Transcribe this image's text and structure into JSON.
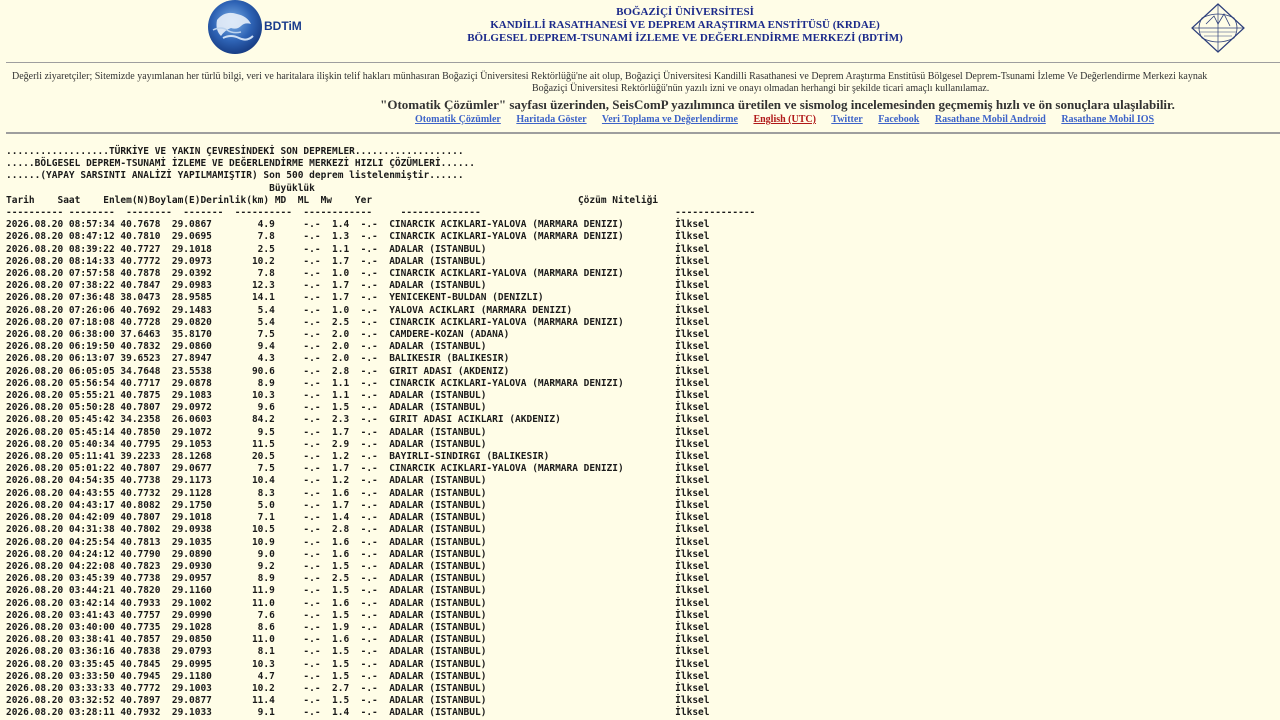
{
  "header": {
    "logo_left_text": "BDTiM",
    "university": "BOĞAZİÇİ ÜNİVERSİTESİ",
    "institute": "KANDİLLİ RASATHANESİ VE DEPREM ARAŞTIRMA ENSTİTÜSÜ (KRDAE)",
    "center": "BÖLGESEL DEPREM-TSUNAMİ İZLEME VE DEĞERLENDİRME MERKEZİ (BDTİM)",
    "colors": {
      "title": "#1B2A8A",
      "background": "#FFFDE7",
      "link": "#3D63C8",
      "link_red": "#B01818"
    },
    "icons": [
      "bdtim-logo-icon",
      "kandilli-logo-icon"
    ]
  },
  "notice": {
    "line1": "Değerli ziyaretçiler; Sitemizde yayımlanan her türlü bilgi, veri ve haritalara ilişkin telif hakları münhasıran Boğaziçi Üniversitesi Rektörlüğü'ne ait olup, Boğaziçi Üniversitesi Kandilli Rasathanesi ve Deprem Araştırma Enstitüsü Bölgesel Deprem-Tsunami İzleme Ve Değerlendirme Merkezi kaynak",
    "line2": "Boğaziçi Üniversitesi Rektörlüğü'nün yazılı izni ve onayı olmadan herhangi bir şekilde ticari amaçlı kullanılamaz."
  },
  "tagline": "\"Otomatik Çözümler\" sayfası üzerinden, SeisComP yazılımınca üretilen ve sismolog incelemesinden geçmemiş hızlı ve ön sonuçlara ulaşılabilir.",
  "nav": [
    "Otomatik Çözümler",
    "Haritada Göster",
    "Veri Toplama ve Değerlendirme",
    "English (UTC)",
    "Twitter",
    "Facebook",
    "Rasathane Mobil Android",
    "Rasathane Mobil IOS"
  ],
  "listing": {
    "banner": [
      "..................TÜRKİYE VE YAKIN ÇEVRESİNDEKİ SON DEPREMLER...................",
      ".....BÖLGESEL DEPREM-TSUNAMİ İZLEME VE DEĞERLENDİRME MERKEZİ HIZLI ÇÖZÜMLERİ......",
      "......(YAPAY SARSINTI ANALİZİ YAPILMAMIŞTIR) Son 500 deprem listelenmiştir......"
    ],
    "magnitude_header": "Büyüklük",
    "columns": [
      "Tarih",
      "Saat",
      "Enlem(N)",
      "Boylam(E)",
      "Derinlik(km)",
      "MD",
      "ML",
      "Mw",
      "Yer",
      "Çözüm Niteliği"
    ],
    "rows": [
      [
        "2026.08.20",
        "08:57:34",
        "40.7678",
        "29.0867",
        "4.9",
        "-.-",
        "1.4",
        "-.-",
        "CINARCIK ACIKLARI-YALOVA (MARMARA DENIZI)",
        "İlksel"
      ],
      [
        "2026.08.20",
        "08:47:12",
        "40.7810",
        "29.0695",
        "7.8",
        "-.-",
        "1.3",
        "-.-",
        "CINARCIK ACIKLARI-YALOVA (MARMARA DENIZI)",
        "İlksel"
      ],
      [
        "2026.08.20",
        "08:39:22",
        "40.7727",
        "29.1018",
        "2.5",
        "-.-",
        "1.1",
        "-.-",
        "ADALAR (ISTANBUL)",
        "İlksel"
      ],
      [
        "2026.08.20",
        "08:14:33",
        "40.7772",
        "29.0973",
        "10.2",
        "-.-",
        "1.7",
        "-.-",
        "ADALAR (ISTANBUL)",
        "İlksel"
      ],
      [
        "2026.08.20",
        "07:57:58",
        "40.7878",
        "29.0392",
        "7.8",
        "-.-",
        "1.0",
        "-.-",
        "CINARCIK ACIKLARI-YALOVA (MARMARA DENIZI)",
        "İlksel"
      ],
      [
        "2026.08.20",
        "07:38:22",
        "40.7847",
        "29.0983",
        "12.3",
        "-.-",
        "1.7",
        "-.-",
        "ADALAR (ISTANBUL)",
        "İlksel"
      ],
      [
        "2026.08.20",
        "07:36:48",
        "38.0473",
        "28.9585",
        "14.1",
        "-.-",
        "1.7",
        "-.-",
        "YENICEKENT-BULDAN (DENIZLI)",
        "İlksel"
      ],
      [
        "2026.08.20",
        "07:26:06",
        "40.7692",
        "29.1483",
        "5.4",
        "-.-",
        "1.0",
        "-.-",
        "YALOVA ACIKLARI (MARMARA DENIZI)",
        "İlksel"
      ],
      [
        "2026.08.20",
        "07:18:08",
        "40.7728",
        "29.0820",
        "5.4",
        "-.-",
        "2.5",
        "-.-",
        "CINARCIK ACIKLARI-YALOVA (MARMARA DENIZI)",
        "İlksel"
      ],
      [
        "2026.08.20",
        "06:38:00",
        "37.6463",
        "35.8170",
        "7.5",
        "-.-",
        "2.0",
        "-.-",
        "CAMDERE-KOZAN (ADANA)",
        "İlksel"
      ],
      [
        "2026.08.20",
        "06:19:50",
        "40.7832",
        "29.0860",
        "9.4",
        "-.-",
        "2.0",
        "-.-",
        "ADALAR (ISTANBUL)",
        "İlksel"
      ],
      [
        "2026.08.20",
        "06:13:07",
        "39.6523",
        "27.8947",
        "4.3",
        "-.-",
        "2.0",
        "-.-",
        "BALIKESIR (BALIKESIR)",
        "İlksel"
      ],
      [
        "2026.08.20",
        "06:05:05",
        "34.7648",
        "23.5538",
        "90.6",
        "-.-",
        "2.8",
        "-.-",
        "GIRIT ADASI (AKDENIZ)",
        "İlksel"
      ],
      [
        "2026.08.20",
        "05:56:54",
        "40.7717",
        "29.0878",
        "8.9",
        "-.-",
        "1.1",
        "-.-",
        "CINARCIK ACIKLARI-YALOVA (MARMARA DENIZI)",
        "İlksel"
      ],
      [
        "2026.08.20",
        "05:55:21",
        "40.7875",
        "29.1083",
        "10.3",
        "-.-",
        "1.1",
        "-.-",
        "ADALAR (ISTANBUL)",
        "İlksel"
      ],
      [
        "2026.08.20",
        "05:50:28",
        "40.7807",
        "29.0972",
        "9.6",
        "-.-",
        "1.5",
        "-.-",
        "ADALAR (ISTANBUL)",
        "İlksel"
      ],
      [
        "2026.08.20",
        "05:45:42",
        "34.2358",
        "26.0603",
        "84.2",
        "-.-",
        "2.3",
        "-.-",
        "GIRIT ADASI ACIKLARI (AKDENIZ)",
        "İlksel"
      ],
      [
        "2026.08.20",
        "05:45:14",
        "40.7850",
        "29.1072",
        "9.5",
        "-.-",
        "1.7",
        "-.-",
        "ADALAR (ISTANBUL)",
        "İlksel"
      ],
      [
        "2026.08.20",
        "05:40:34",
        "40.7795",
        "29.1053",
        "11.5",
        "-.-",
        "2.9",
        "-.-",
        "ADALAR (ISTANBUL)",
        "İlksel"
      ],
      [
        "2026.08.20",
        "05:11:41",
        "39.2233",
        "28.1268",
        "20.5",
        "-.-",
        "1.2",
        "-.-",
        "BAYIRLI-SINDIRGI (BALIKESIR)",
        "İlksel"
      ],
      [
        "2026.08.20",
        "05:01:22",
        "40.7807",
        "29.0677",
        "7.5",
        "-.-",
        "1.7",
        "-.-",
        "CINARCIK ACIKLARI-YALOVA (MARMARA DENIZI)",
        "İlksel"
      ],
      [
        "2026.08.20",
        "04:54:35",
        "40.7738",
        "29.1173",
        "10.4",
        "-.-",
        "1.2",
        "-.-",
        "ADALAR (ISTANBUL)",
        "İlksel"
      ],
      [
        "2026.08.20",
        "04:43:55",
        "40.7732",
        "29.1128",
        "8.3",
        "-.-",
        "1.6",
        "-.-",
        "ADALAR (ISTANBUL)",
        "İlksel"
      ],
      [
        "2026.08.20",
        "04:43:17",
        "40.8082",
        "29.1750",
        "5.0",
        "-.-",
        "1.7",
        "-.-",
        "ADALAR (ISTANBUL)",
        "İlksel"
      ],
      [
        "2026.08.20",
        "04:42:09",
        "40.7807",
        "29.1018",
        "7.1",
        "-.-",
        "1.4",
        "-.-",
        "ADALAR (ISTANBUL)",
        "İlksel"
      ],
      [
        "2026.08.20",
        "04:31:38",
        "40.7802",
        "29.0938",
        "10.5",
        "-.-",
        "2.8",
        "-.-",
        "ADALAR (ISTANBUL)",
        "İlksel"
      ],
      [
        "2026.08.20",
        "04:25:54",
        "40.7813",
        "29.1035",
        "10.9",
        "-.-",
        "1.6",
        "-.-",
        "ADALAR (ISTANBUL)",
        "İlksel"
      ],
      [
        "2026.08.20",
        "04:24:12",
        "40.7790",
        "29.0890",
        "9.0",
        "-.-",
        "1.6",
        "-.-",
        "ADALAR (ISTANBUL)",
        "İlksel"
      ],
      [
        "2026.08.20",
        "04:22:08",
        "40.7823",
        "29.0930",
        "9.2",
        "-.-",
        "1.5",
        "-.-",
        "ADALAR (ISTANBUL)",
        "İlksel"
      ],
      [
        "2026.08.20",
        "03:45:39",
        "40.7738",
        "29.0957",
        "8.9",
        "-.-",
        "2.5",
        "-.-",
        "ADALAR (ISTANBUL)",
        "İlksel"
      ],
      [
        "2026.08.20",
        "03:44:21",
        "40.7820",
        "29.1160",
        "11.9",
        "-.-",
        "1.5",
        "-.-",
        "ADALAR (ISTANBUL)",
        "İlksel"
      ],
      [
        "2026.08.20",
        "03:42:14",
        "40.7933",
        "29.1002",
        "11.0",
        "-.-",
        "1.6",
        "-.-",
        "ADALAR (ISTANBUL)",
        "İlksel"
      ],
      [
        "2026.08.20",
        "03:41:43",
        "40.7757",
        "29.0990",
        "7.6",
        "-.-",
        "1.5",
        "-.-",
        "ADALAR (ISTANBUL)",
        "İlksel"
      ],
      [
        "2026.08.20",
        "03:40:00",
        "40.7735",
        "29.1028",
        "8.6",
        "-.-",
        "1.9",
        "-.-",
        "ADALAR (ISTANBUL)",
        "İlksel"
      ],
      [
        "2026.08.20",
        "03:38:41",
        "40.7857",
        "29.0850",
        "11.0",
        "-.-",
        "1.6",
        "-.-",
        "ADALAR (ISTANBUL)",
        "İlksel"
      ],
      [
        "2026.08.20",
        "03:36:16",
        "40.7838",
        "29.0793",
        "8.1",
        "-.-",
        "1.5",
        "-.-",
        "ADALAR (ISTANBUL)",
        "İlksel"
      ],
      [
        "2026.08.20",
        "03:35:45",
        "40.7845",
        "29.0995",
        "10.3",
        "-.-",
        "1.5",
        "-.-",
        "ADALAR (ISTANBUL)",
        "İlksel"
      ],
      [
        "2026.08.20",
        "03:33:50",
        "40.7945",
        "29.1180",
        "4.7",
        "-.-",
        "1.5",
        "-.-",
        "ADALAR (ISTANBUL)",
        "İlksel"
      ],
      [
        "2026.08.20",
        "03:33:33",
        "40.7772",
        "29.1003",
        "10.2",
        "-.-",
        "2.7",
        "-.-",
        "ADALAR (ISTANBUL)",
        "İlksel"
      ],
      [
        "2026.08.20",
        "03:32:52",
        "40.7897",
        "29.0877",
        "11.4",
        "-.-",
        "1.5",
        "-.-",
        "ADALAR (ISTANBUL)",
        "İlksel"
      ],
      [
        "2026.08.20",
        "03:28:11",
        "40.7932",
        "29.1033",
        "9.1",
        "-.-",
        "1.4",
        "-.-",
        "ADALAR (ISTANBUL)",
        "İlksel"
      ]
    ]
  }
}
